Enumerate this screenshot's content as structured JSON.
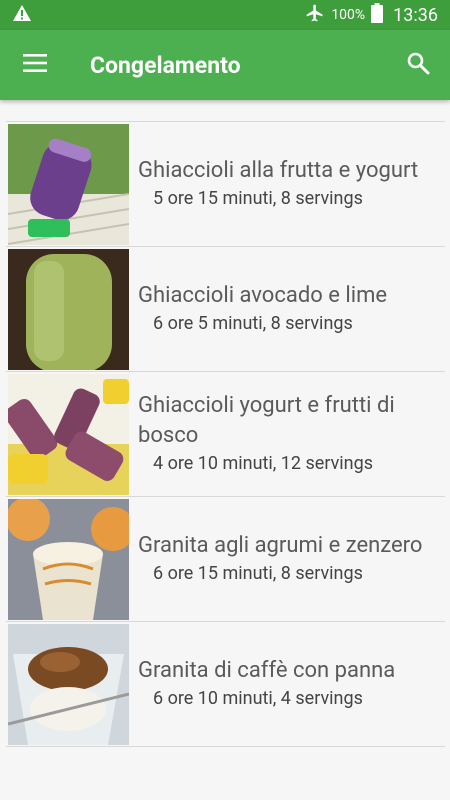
{
  "status_bar": {
    "battery": "100%",
    "time": "13:36",
    "icons": [
      "warning-icon",
      "airplane-icon",
      "battery-icon"
    ]
  },
  "app_bar": {
    "title": "Congelamento",
    "icons": [
      "menu-icon",
      "search-icon"
    ]
  },
  "recipes": [
    {
      "title": "Ghiaccioli alla frutta e yogurt",
      "meta": "5 ore 15 minuti, 8 servings"
    },
    {
      "title": "Ghiaccioli avocado e lime",
      "meta": "6 ore 5 minuti, 8 servings"
    },
    {
      "title": "Ghiaccioli yogurt e frutti di bosco",
      "meta": "4 ore 10 minuti, 12 servings"
    },
    {
      "title": "Granita agli agrumi e zenzero",
      "meta": "6 ore 15 minuti, 8 servings"
    },
    {
      "title": "Granita di caffè con panna",
      "meta": "6 ore 10 minuti, 4 servings"
    }
  ],
  "colors": {
    "status_bar": "#3e9e3c",
    "app_bar": "#4caf50",
    "background": "#f6f6f6"
  }
}
